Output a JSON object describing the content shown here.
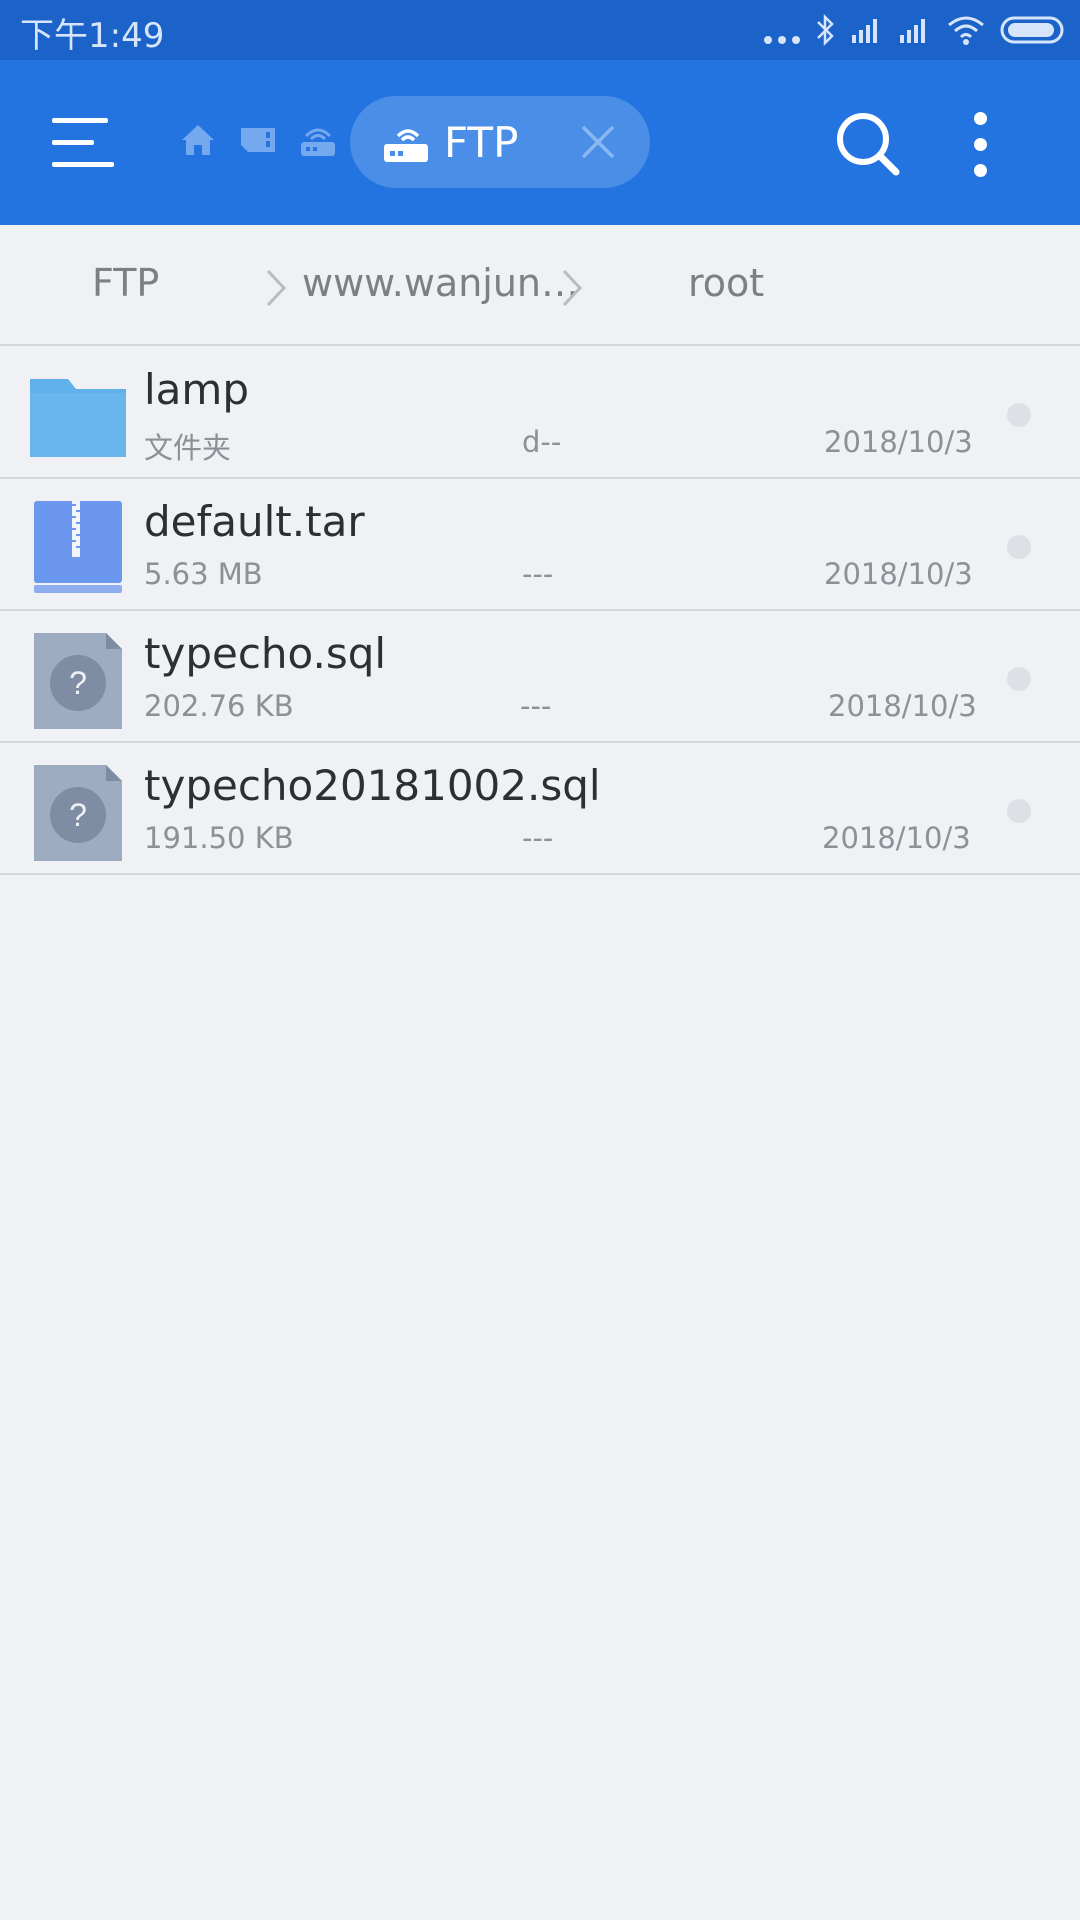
{
  "status_bar": {
    "time": "下午1:49",
    "icons": [
      "more-dots-icon",
      "bluetooth-icon",
      "signal-icon",
      "signal-icon",
      "wifi-icon",
      "battery-icon"
    ]
  },
  "toolbar": {
    "active_tab_label": "FTP",
    "accent_color": "#2374e1",
    "icons": [
      "menu-icon",
      "home-icon",
      "storage-icon",
      "network-icon",
      "ftp-icon",
      "close-icon",
      "search-icon",
      "more-vert-icon"
    ]
  },
  "breadcrumb": {
    "items": [
      "FTP",
      "www.wanjun…",
      "root"
    ]
  },
  "files": [
    {
      "name": "lamp",
      "meta": "文件夹",
      "perm": "d--",
      "date": "2018/10/3",
      "icon": "folder-icon"
    },
    {
      "name": "default.tar",
      "meta": "5.63 MB",
      "perm": "---",
      "date": "2018/10/3",
      "icon": "archive-icon"
    },
    {
      "name": "typecho.sql",
      "meta": "202.76 KB",
      "perm": "---",
      "date": "2018/10/3",
      "icon": "unknown-file-icon"
    },
    {
      "name": "typecho20181002.sql",
      "meta": "191.50 KB",
      "perm": "---",
      "date": "2018/10/3",
      "icon": "unknown-file-icon"
    }
  ]
}
